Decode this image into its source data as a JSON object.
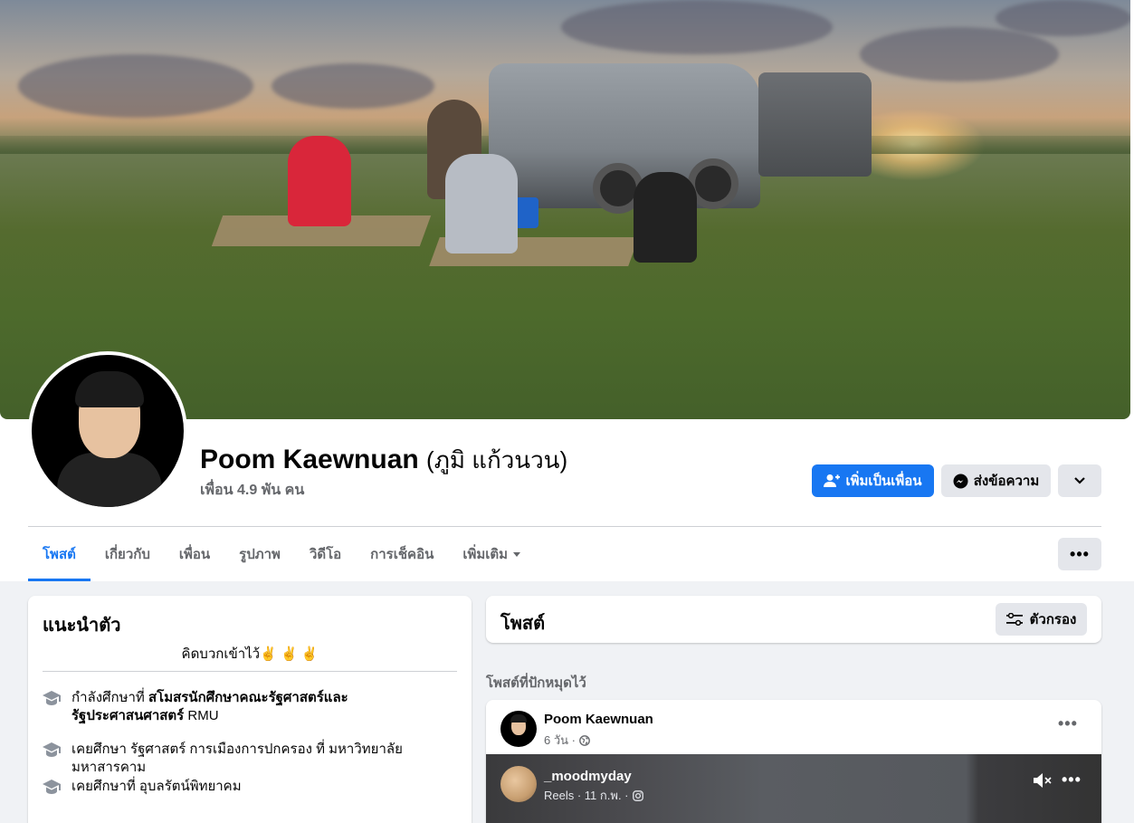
{
  "profile": {
    "name": "Poom Kaewnuan",
    "alternate_name": "(ภูมิ แก้วนวน)",
    "friends": "เพื่อน 4.9 พัน คน"
  },
  "actions": {
    "add_friend": "เพิ่มเป็นเพื่อน",
    "message": "ส่งข้อความ"
  },
  "tabs": [
    {
      "label": "โพสต์",
      "active": true
    },
    {
      "label": "เกี่ยวกับ"
    },
    {
      "label": "เพื่อน"
    },
    {
      "label": "รูปภาพ"
    },
    {
      "label": "วิดีโอ"
    },
    {
      "label": "การเช็คอิน"
    },
    {
      "label": "เพิ่มเติม"
    }
  ],
  "intro": {
    "title": "แนะนำตัว",
    "bio": "คิดบวกเข้าไว้✌️ ✌️ ✌️",
    "items": [
      {
        "prefix": "กำลังศึกษาที่ ",
        "bold": "สโมสรนักศึกษาคณะรัฐศาสตร์และรัฐประศาสนศาสตร์",
        "suffix": " RMU"
      },
      {
        "prefix": "เคยศึกษา รัฐศาสตร์ การเมืองการปกครอง ที่ มหาวิทยาลัยมหาสารคาม",
        "bold": "",
        "suffix": ""
      },
      {
        "prefix": "เคยศึกษาที่ อุบลรัตน์พิทยาคม",
        "bold": "",
        "suffix": ""
      }
    ]
  },
  "posts": {
    "title": "โพสต์",
    "filter_label": "ตัวกรอง",
    "pinned_label": "โพสต์ที่ปักหมุดไว้"
  },
  "post": {
    "author": "Poom Kaewnuan",
    "time": "6 วัน ·"
  },
  "reel": {
    "user": "_moodmyday",
    "meta": "Reels · 11 ก.พ. ·"
  },
  "colors": {
    "accent": "#1877f2",
    "secondary_button": "#e4e6eb",
    "muted_text": "#65676b"
  }
}
